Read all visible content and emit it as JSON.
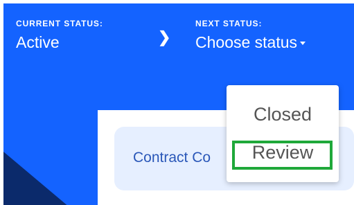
{
  "current": {
    "label": "CURRENT STATUS:",
    "value": "Active"
  },
  "next": {
    "label": "NEXT STATUS:",
    "value": "Choose status"
  },
  "separator_icon": "chevron-right-icon",
  "dropdown_icon": "caret-down-icon",
  "contract": {
    "text": "Contract Co"
  },
  "menu": {
    "items": [
      {
        "label": "Closed"
      },
      {
        "label": "Review"
      }
    ]
  },
  "colors": {
    "header_bg": "#1463ff",
    "corner_bg": "#0b2a6b",
    "card_bg": "#e6efff",
    "card_text": "#2a57b8",
    "highlight": "#1fa83a"
  }
}
